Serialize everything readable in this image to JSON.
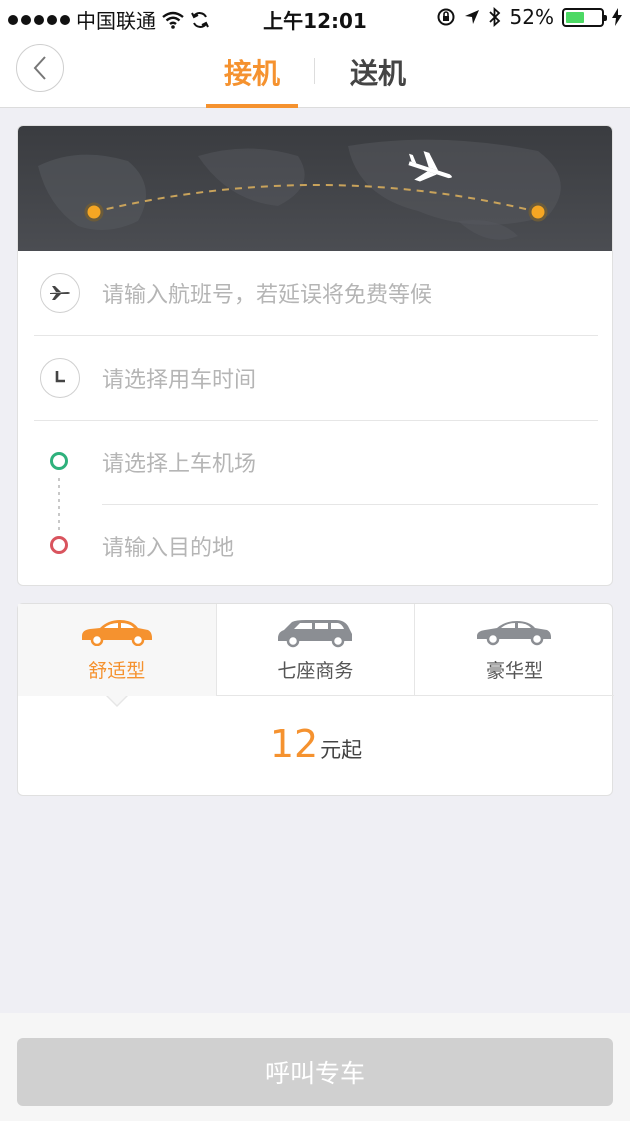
{
  "status_bar": {
    "carrier": "中国联通",
    "time": "上午12:01",
    "battery": "52%",
    "battery_level": 0.52
  },
  "nav": {
    "tabs": [
      {
        "label": "接机",
        "active": true
      },
      {
        "label": "送机",
        "active": false
      }
    ]
  },
  "form": {
    "flight_placeholder": "请输入航班号，若延误将免费等候",
    "time_placeholder": "请选择用车时间",
    "airport_placeholder": "请选择上车机场",
    "destination_placeholder": "请输入目的地"
  },
  "car_types": [
    {
      "label": "舒适型",
      "active": true
    },
    {
      "label": "七座商务",
      "active": false
    },
    {
      "label": "豪华型",
      "active": false
    }
  ],
  "price": {
    "amount": "12",
    "unit": "元起"
  },
  "call_button": "呼叫专车",
  "colors": {
    "accent": "#f5922f",
    "start_dot": "#2eb17c",
    "end_dot": "#d9545e",
    "button_disabled": "#d0d0d0"
  }
}
